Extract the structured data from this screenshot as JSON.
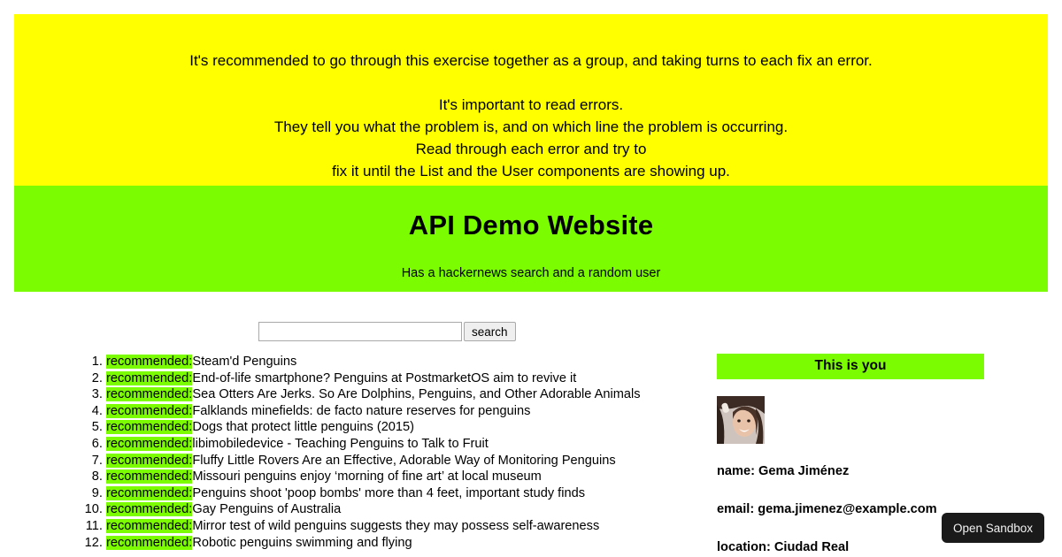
{
  "instructions": {
    "line1": "It's recommended to go through this exercise together as a group, and taking turns to each fix an error.",
    "line2": "It's important to read errors.",
    "line3": "They tell you what the problem is, and on which line the problem is occurring.",
    "line4": "Read through each error and try to",
    "line5": "fix it until the List and the User components are showing up.",
    "background_color": "#ffff00"
  },
  "header": {
    "title": "API Demo Website",
    "subtitle": "Has a hackernews search and a random user",
    "background_color": "#7cfc00"
  },
  "search": {
    "value": "",
    "placeholder": "",
    "button_label": "search"
  },
  "stories": {
    "tag_label": "recommended:",
    "tag_highlight_color": "#7cfc00",
    "items": [
      "Steam'd Penguins",
      "End-of-life smartphone? Penguins at PostmarketOS aim to revive it",
      "Sea Otters Are Jerks. So Are Dolphins, Penguins, and Other Adorable Animals",
      "Falklands minefields: de facto nature reserves for penguins",
      "Dogs that protect little penguins (2015)",
      "libimobiledevice - Teaching Penguins to Talk to Fruit",
      "Fluffy Little Rovers Are an Effective, Adorable Way of Monitoring Penguins",
      "Missouri penguins enjoy ‘morning of fine art’ at local museum",
      "Penguins shoot 'poop bombs' more than 4 feet, important study finds",
      "Gay Penguins of Australia",
      "Mirror test of wild penguins suggests they may possess self-awareness",
      "Robotic penguins swimming and flying"
    ]
  },
  "user": {
    "panel_title": "This is you",
    "panel_title_background": "#7cfc00",
    "avatar_alt": "user-portrait-photo",
    "name": "name: Gema Jiménez",
    "email": "email: gema.jimenez@example.com",
    "location": "location: Ciudad Real"
  },
  "sandbox": {
    "label": "Open Sandbox",
    "background_color": "#1a1a1a",
    "text_color": "#f2f2f2"
  }
}
